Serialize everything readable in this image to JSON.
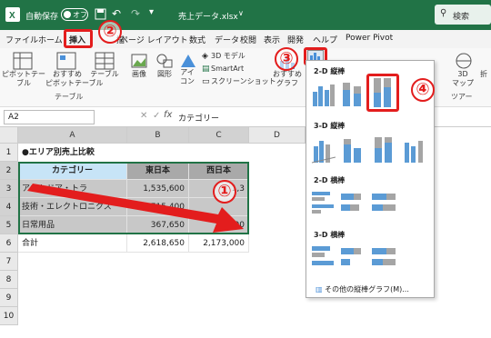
{
  "titlebar": {
    "autosave": "自動保存",
    "toggle": "オフ",
    "filename": "売上データ.xlsx",
    "search": "検索"
  },
  "tabs": [
    "ファイル",
    "ホーム",
    "挿入",
    "描",
    "ページ レイアウト",
    "数式",
    "データ",
    "校閲",
    "表示",
    "開発",
    "ヘルプ",
    "Power Pivot"
  ],
  "ribbon": {
    "pivot": "ピボットテー\nブル",
    "rec_pivot": "おすすめ\nピボットテーブル",
    "table": "テーブル",
    "group_table": "テーブル",
    "image": "画像",
    "shape": "図形",
    "icon": "アイ\nコン",
    "model3d": "3D モデル",
    "smartart": "SmartArt",
    "screenshot": "スクリーンショット",
    "rec_chart": "おすすめ\nグラフ",
    "model3d_map": "3D\nマップ",
    "group_tour": "ツアー",
    "sparkline": "折"
  },
  "formula_bar": {
    "cell": "A2",
    "fx": "fx",
    "value": "カテゴリー"
  },
  "columns": [
    "A",
    "B",
    "C",
    "D"
  ],
  "rows": [
    "1",
    "2",
    "3",
    "4",
    "5",
    "6",
    "7",
    "8",
    "9",
    "10"
  ],
  "sheet": {
    "title": "●エリア別売上比較",
    "headers": [
      "カテゴリー",
      "東日本",
      "西日本"
    ],
    "data": [
      [
        "アウトドア・トラ",
        "1,535,600",
        "1,3"
      ],
      [
        "技術・エレクトロニクス",
        "715,400",
        ""
      ],
      [
        "日常用品",
        "367,650",
        "27,900"
      ],
      [
        "合計",
        "2,618,650",
        "2,173,000"
      ]
    ]
  },
  "dropdown": {
    "sec2d_col": "2-D 縦棒",
    "sec3d_col": "3-D 縦棒",
    "sec2d_bar": "2-D 横棒",
    "sec3d_bar": "3-D 横棒",
    "more": "その他の縦棒グラフ(M)..."
  },
  "badges": [
    "②",
    "③",
    "④",
    "①"
  ],
  "colors": {
    "excel_green": "#217346",
    "selection_red": "#e31d1d",
    "header_blue": "#c7e4f7",
    "bar_blue": "#5b9bd5"
  }
}
